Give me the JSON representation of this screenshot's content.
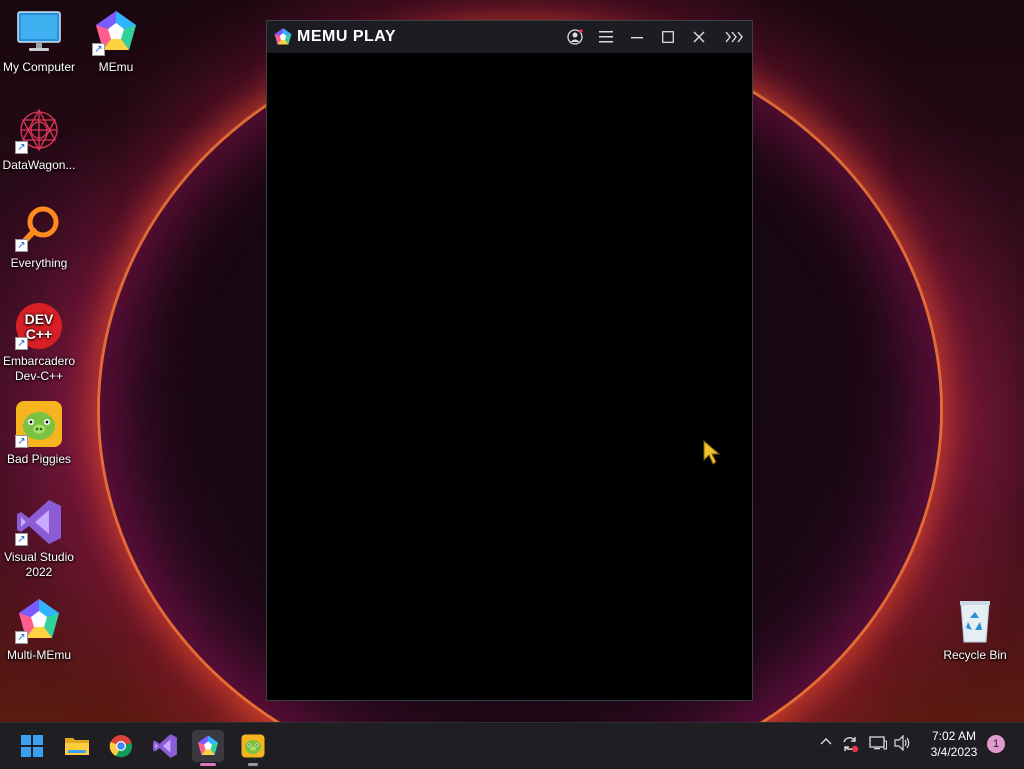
{
  "desktop": {
    "icons": [
      {
        "label": "My Computer",
        "icon": "monitor-icon"
      },
      {
        "label": "MEmu",
        "icon": "memu-icon"
      },
      {
        "label": "DataWagon...",
        "icon": "datawagon-icon"
      },
      {
        "label": "Everything",
        "icon": "search-magnifier-icon"
      },
      {
        "label": "Embarcadero Dev-C++",
        "icon": "devcpp-icon",
        "glyph": "DEV C++"
      },
      {
        "label": "Bad Piggies",
        "icon": "bad-piggies-icon"
      },
      {
        "label": "Visual Studio 2022",
        "icon": "visual-studio-icon"
      },
      {
        "label": "Multi-MEmu",
        "icon": "multi-memu-icon"
      },
      {
        "label": "Recycle Bin",
        "icon": "recycle-bin-icon"
      }
    ]
  },
  "emulator": {
    "title": "MEMU PLAY",
    "buttons": {
      "account": "account-icon",
      "menu": "hamburger-menu-icon",
      "minimize": "minimize-icon",
      "maximize": "maximize-icon",
      "close": "close-icon",
      "sidebar": "expand-sidebar-icon"
    }
  },
  "taskbar": {
    "apps": [
      {
        "name": "Start",
        "icon": "windows-start-icon"
      },
      {
        "name": "File Explorer",
        "icon": "folder-icon"
      },
      {
        "name": "Google Chrome",
        "icon": "chrome-icon"
      },
      {
        "name": "Visual Studio",
        "icon": "visual-studio-icon"
      },
      {
        "name": "MEmu",
        "icon": "memu-icon",
        "active": true
      },
      {
        "name": "Bad Piggies",
        "icon": "bad-piggies-icon"
      }
    ],
    "tray": {
      "time": "7:02 AM",
      "date": "3/4/2023",
      "notifications": "1"
    }
  },
  "colors": {
    "taskbar_bg": "#1f1e23",
    "titlebar_bg": "#1b1d22",
    "accent_pink": "#e07ab6"
  }
}
